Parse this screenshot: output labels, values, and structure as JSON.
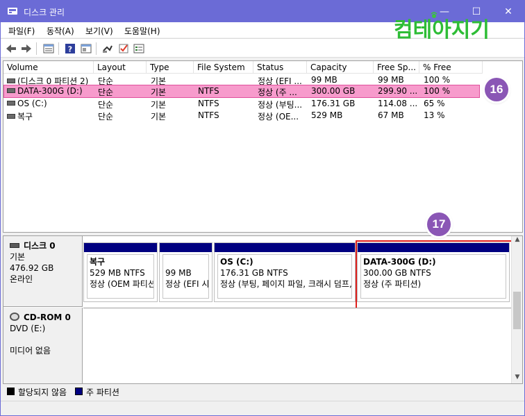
{
  "window": {
    "title": "디스크 관리",
    "minimize_glyph": "—",
    "maximize_glyph": "☐",
    "close_glyph": "✕",
    "titlebar_color": "#6b6bd6"
  },
  "watermark": {
    "text": "컴테아지기",
    "color": "#2ebd36"
  },
  "menu": [
    "파일(F)",
    "동작(A)",
    "보기(V)",
    "도움말(H)"
  ],
  "toolbar": {
    "icons": [
      "back-icon",
      "forward-icon",
      "show-list-icon",
      "help-icon",
      "properties-icon",
      "connect-icon",
      "check-icon",
      "properties-sheet-icon"
    ]
  },
  "volume_list": {
    "columns": [
      "Volume",
      "Layout",
      "Type",
      "File System",
      "Status",
      "Capacity",
      "Free Sp...",
      "% Free"
    ],
    "rows": [
      {
        "volume": "(디스크 0 파티션 2)",
        "layout": "단순",
        "type": "기본",
        "fs": "",
        "status": "정상 (EFI ...",
        "capacity": "99 MB",
        "free": "99 MB",
        "pct": "100 %"
      },
      {
        "volume": "DATA-300G (D:)",
        "layout": "단순",
        "type": "기본",
        "fs": "NTFS",
        "status": "정상 (주 ...",
        "capacity": "300.00 GB",
        "free": "299.90 ...",
        "pct": "100 %"
      },
      {
        "volume": "OS (C:)",
        "layout": "단순",
        "type": "기본",
        "fs": "NTFS",
        "status": "정상 (부팅...",
        "capacity": "176.31 GB",
        "free": "114.08 ...",
        "pct": "65 %"
      },
      {
        "volume": "복구",
        "layout": "단순",
        "type": "기본",
        "fs": "NTFS",
        "status": "정상 (OE...",
        "capacity": "529 MB",
        "free": "67 MB",
        "pct": "13 %"
      }
    ],
    "selected_row": 1,
    "selection_color": "#f79bcc"
  },
  "badges": {
    "b16": "16",
    "b17": "17",
    "color": "#8a56b5"
  },
  "disks": [
    {
      "name": "디스크 0",
      "type": "기본",
      "size": "476.92 GB",
      "state": "온라인",
      "partitions": [
        {
          "name": "복구",
          "size": "529 MB NTFS",
          "status": "정상 (OEM 파티션)"
        },
        {
          "name": "",
          "size": "99 MB",
          "status": "정상 (EFI 시스템 파티션)"
        },
        {
          "name": "OS  (C:)",
          "size": "176.31 GB NTFS",
          "status": "정상 (부팅, 페이지 파일, 크래시 덤프, 주 파티션)"
        },
        {
          "name": "DATA-300G  (D:)",
          "size": "300.00 GB NTFS",
          "status": "정상 (주 파티션)"
        }
      ]
    },
    {
      "name": "CD-ROM 0",
      "type": "DVD (E:)",
      "state": "미디어 없음"
    }
  ],
  "legend": [
    {
      "label": "할당되지 않음",
      "color": "#000000"
    },
    {
      "label": "주 파티션",
      "color": "#000080"
    }
  ],
  "highlight_color": "#e0201c"
}
